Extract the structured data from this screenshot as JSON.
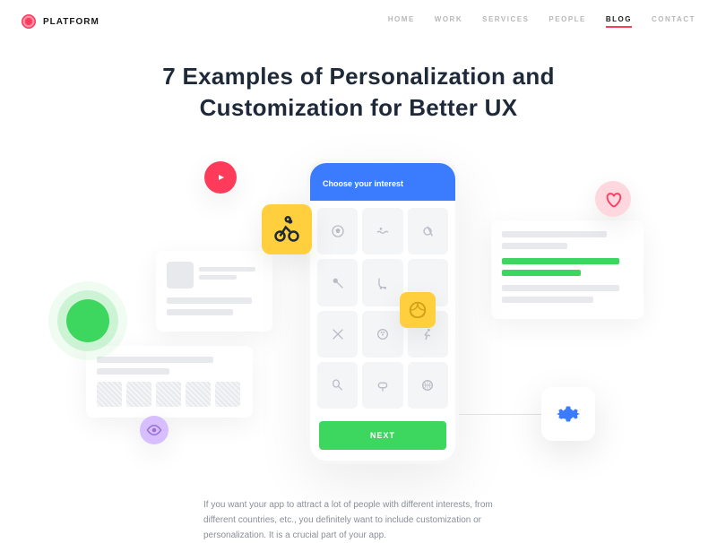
{
  "brand": "PLATFORM",
  "nav": {
    "home": "HOME",
    "work": "WORK",
    "services": "SERVICES",
    "people": "PEOPLE",
    "blog": "BLOG",
    "contact": "CONTACT"
  },
  "title": "7 Examples of Personalization and Customization for Better UX",
  "phone": {
    "header": "Choose your interest",
    "next": "NEXT"
  },
  "body_text": "If you want your app to attract a lot of people with different interests, from different countries, etc., you definitely want to include customization or personalization. It is a crucial part of your app."
}
